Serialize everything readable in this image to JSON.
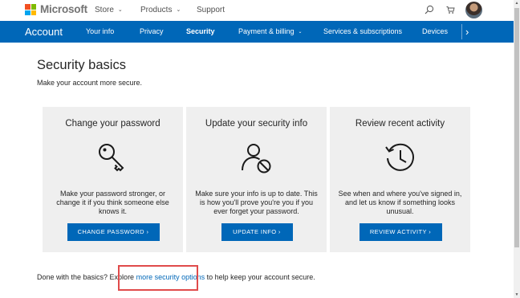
{
  "header": {
    "brand": "Microsoft",
    "nav": [
      {
        "label": "Store",
        "has_dropdown": true
      },
      {
        "label": "Products",
        "has_dropdown": true
      },
      {
        "label": "Support",
        "has_dropdown": false
      }
    ],
    "icons": [
      "search-icon",
      "cart-icon",
      "avatar"
    ]
  },
  "account_nav": {
    "title": "Account",
    "items": [
      {
        "label": "Your info",
        "active": false
      },
      {
        "label": "Privacy",
        "active": false
      },
      {
        "label": "Security",
        "active": true
      },
      {
        "label": "Payment & billing",
        "active": false,
        "has_dropdown": true
      },
      {
        "label": "Services & subscriptions",
        "active": false
      },
      {
        "label": "Devices",
        "active": false
      }
    ],
    "more_glyph": "›"
  },
  "page": {
    "title": "Security basics",
    "subtitle": "Make your account more secure."
  },
  "cards": [
    {
      "title": "Change your password",
      "icon": "key-icon",
      "description": "Make your password stronger, or change it if you think someone else knows it.",
      "button": "CHANGE PASSWORD"
    },
    {
      "title": "Update your security info",
      "icon": "user-blocked-icon",
      "description": "Make sure your info is up to date. This is how you'll prove you're you if you ever forget your password.",
      "button": "UPDATE INFO"
    },
    {
      "title": "Review recent activity",
      "icon": "history-clock-icon",
      "description": "See when and where you've signed in, and let us know if something looks unusual.",
      "button": "REVIEW ACTIVITY"
    }
  ],
  "footer": {
    "before": "Done with the basics? Explore ",
    "link": "more security options",
    "after": " to help keep your account secure."
  },
  "colors": {
    "brand_blue": "#0067b8",
    "card_bg": "#efefef",
    "highlight": "#e04b4b"
  }
}
